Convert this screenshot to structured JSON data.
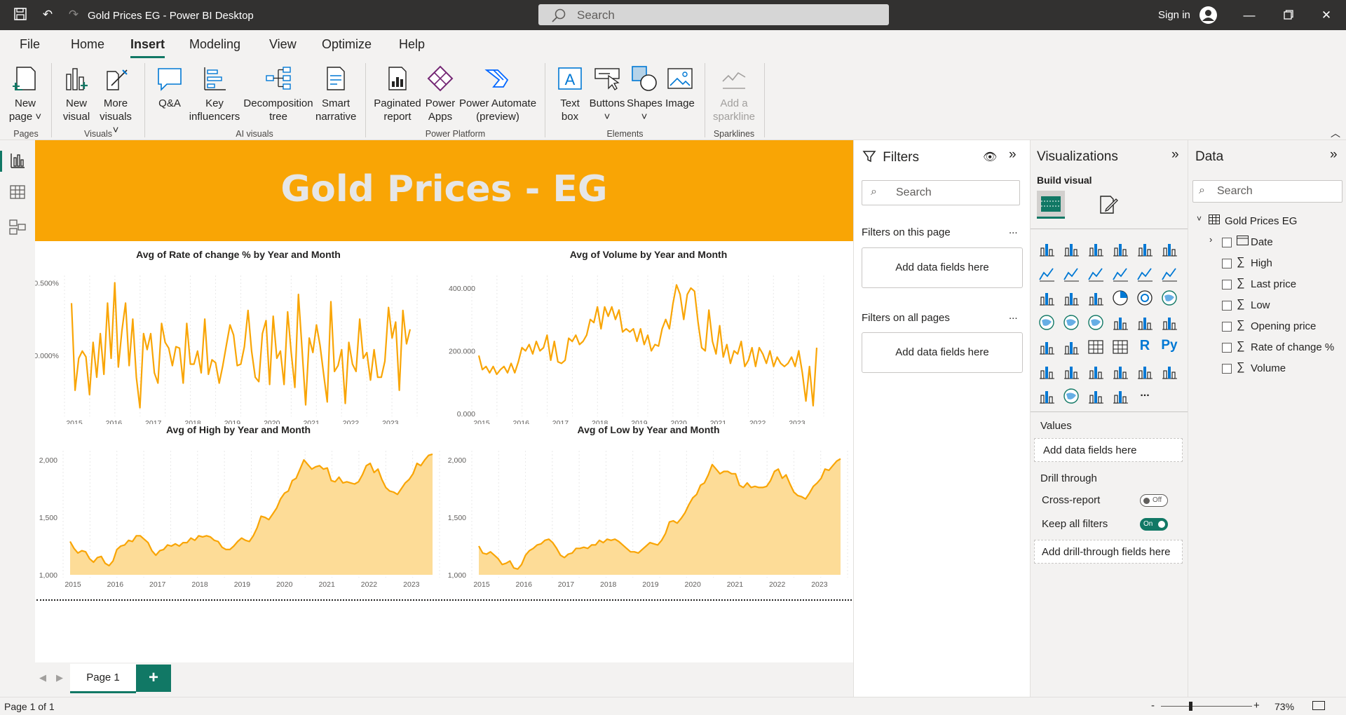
{
  "titlebar": {
    "app_title": "Gold Prices EG - Power BI Desktop",
    "search_placeholder": "Search",
    "sign_in": "Sign in"
  },
  "menu": {
    "tabs": [
      "File",
      "Home",
      "Insert",
      "Modeling",
      "View",
      "Optimize",
      "Help"
    ],
    "active": "Insert"
  },
  "ribbon": {
    "new_page": "New page",
    "new_visual": "New visual",
    "more_visuals": "More visuals",
    "qa": "Q&A",
    "key_influencers": "Key influencers",
    "decomposition_tree": "Decomposition tree",
    "smart_narrative": "Smart narrative",
    "paginated_report": "Paginated report",
    "power_apps": "Power Apps",
    "power_automate": "Power Automate (preview)",
    "text_box": "Text box",
    "buttons": "Buttons",
    "shapes": "Shapes",
    "image": "Image",
    "add_sparkline": "Add a sparkline",
    "groups": {
      "pages": "Pages",
      "visuals": "Visuals",
      "ai_visuals": "AI visuals",
      "power_platform": "Power Platform",
      "elements": "Elements",
      "sparklines": "Sparklines"
    }
  },
  "report": {
    "banner_title": "Gold Prices - EG",
    "banner_color": "#f9a505",
    "accent_color": "#f9a505",
    "area_fill": "#fddc97"
  },
  "chart_data": [
    {
      "type": "line",
      "title": "Avg of Rate of change % by Year and Month",
      "x_ticks": [
        "2015",
        "2016",
        "2017",
        "2018",
        "2019",
        "2020",
        "2021",
        "2022",
        "2023"
      ],
      "y_ticks": [
        "0.000%",
        "0.500%"
      ],
      "grid": true,
      "series": [
        {
          "values": [
            0.36,
            -0.24,
            -0.02,
            0.03,
            -0.01,
            -0.27,
            0.09,
            -0.15,
            0.15,
            -0.13,
            0.36,
            -0.02,
            0.5,
            -0.08,
            0.17,
            0.36,
            -0.07,
            0.25,
            -0.15,
            -0.36,
            0.15,
            0.04,
            0.15,
            -0.12,
            -0.19,
            0.22,
            0.09,
            0.05,
            -0.07,
            0.06,
            0.05,
            -0.19,
            0.22,
            -0.06,
            -0.06,
            0.03,
            -0.12,
            0.25,
            -0.13,
            -0.03,
            -0.05,
            -0.19,
            -0.07,
            0.07,
            0.21,
            0.14,
            -0.07,
            -0.06,
            0.06,
            0.31,
            0.03,
            -0.15,
            -0.18,
            0.15,
            0.24,
            -0.2,
            0.27,
            -0.02,
            0.03,
            -0.2,
            0.3,
            0.02,
            -0.22,
            0.42,
            0.04,
            -0.34,
            0.12,
            0.02,
            0.21,
            0.07,
            -0.13,
            -0.32,
            0.37,
            -0.11,
            -0.07,
            0.04,
            -0.33,
            0.09,
            -0.06,
            -0.11,
            0.25,
            -0.02,
            0.02,
            -0.17,
            0.04,
            -0.15,
            -0.15,
            -0.04,
            0.33,
            0.12,
            0.23,
            -0.24,
            0.31,
            0.08,
            0.18
          ]
        }
      ]
    },
    {
      "type": "line",
      "title": "Avg of Volume by Year and Month",
      "x_ticks": [
        "2015",
        "2016",
        "2017",
        "2018",
        "2019",
        "2020",
        "2021",
        "2022",
        "2023"
      ],
      "y_ticks": [
        "0.000",
        "200.000",
        "400.000"
      ],
      "grid": true,
      "series": [
        {
          "values": [
            185,
            140,
            150,
            130,
            150,
            125,
            140,
            150,
            130,
            160,
            130,
            165,
            210,
            200,
            220,
            190,
            230,
            200,
            210,
            250,
            170,
            230,
            165,
            160,
            170,
            240,
            230,
            250,
            220,
            230,
            250,
            300,
            290,
            340,
            270,
            340,
            310,
            340,
            300,
            330,
            260,
            270,
            260,
            270,
            230,
            270,
            220,
            250,
            200,
            220,
            215,
            270,
            300,
            270,
            350,
            410,
            380,
            300,
            380,
            400,
            390,
            290,
            210,
            200,
            330,
            230,
            190,
            280,
            180,
            220,
            160,
            200,
            190,
            230,
            150,
            170,
            210,
            150,
            210,
            190,
            160,
            200,
            150,
            180,
            160,
            150,
            160,
            180,
            150,
            200,
            130,
            40,
            150,
            25,
            210
          ]
        }
      ]
    },
    {
      "type": "area",
      "title": "Avg of High by Year and Month",
      "x_ticks": [
        "2015",
        "2016",
        "2017",
        "2018",
        "2019",
        "2020",
        "2021",
        "2022",
        "2023"
      ],
      "y_ticks": [
        "1,000",
        "1,500",
        "2,000"
      ],
      "grid": true,
      "series": [
        {
          "values": [
            1290,
            1230,
            1190,
            1210,
            1200,
            1140,
            1110,
            1150,
            1160,
            1100,
            1080,
            1120,
            1220,
            1250,
            1260,
            1300,
            1290,
            1340,
            1340,
            1310,
            1280,
            1210,
            1170,
            1210,
            1220,
            1260,
            1250,
            1270,
            1250,
            1280,
            1280,
            1320,
            1300,
            1340,
            1330,
            1340,
            1330,
            1300,
            1290,
            1240,
            1220,
            1220,
            1250,
            1290,
            1320,
            1300,
            1290,
            1340,
            1410,
            1510,
            1500,
            1480,
            1530,
            1580,
            1660,
            1710,
            1730,
            1820,
            1840,
            1920,
            2000,
            1960,
            1920,
            1940,
            1950,
            1920,
            1930,
            1820,
            1810,
            1850,
            1800,
            1810,
            1800,
            1790,
            1810,
            1870,
            1950,
            1970,
            1890,
            1920,
            1830,
            1760,
            1730,
            1720,
            1700,
            1750,
            1800,
            1830,
            1880,
            1970,
            1950,
            2000,
            2040,
            2050
          ]
        }
      ]
    },
    {
      "type": "area",
      "title": "Avg of Low by Year and Month",
      "x_ticks": [
        "2015",
        "2016",
        "2017",
        "2018",
        "2019",
        "2020",
        "2021",
        "2022",
        "2023"
      ],
      "y_ticks": [
        "1,000",
        "1,500",
        "2,000"
      ],
      "grid": true,
      "series": [
        {
          "values": [
            1250,
            1190,
            1180,
            1200,
            1170,
            1140,
            1090,
            1100,
            1120,
            1060,
            1050,
            1090,
            1170,
            1210,
            1230,
            1260,
            1270,
            1300,
            1310,
            1280,
            1230,
            1170,
            1150,
            1180,
            1190,
            1230,
            1230,
            1240,
            1230,
            1260,
            1260,
            1300,
            1280,
            1310,
            1300,
            1310,
            1290,
            1260,
            1230,
            1200,
            1200,
            1190,
            1220,
            1250,
            1280,
            1270,
            1260,
            1300,
            1360,
            1460,
            1470,
            1450,
            1490,
            1540,
            1610,
            1670,
            1700,
            1780,
            1800,
            1870,
            1960,
            1920,
            1880,
            1900,
            1900,
            1880,
            1880,
            1780,
            1760,
            1800,
            1760,
            1770,
            1760,
            1760,
            1770,
            1820,
            1900,
            1920,
            1840,
            1870,
            1790,
            1720,
            1690,
            1680,
            1660,
            1710,
            1770,
            1800,
            1840,
            1920,
            1910,
            1950,
            1990,
            2010
          ]
        }
      ]
    }
  ],
  "pages": {
    "current_tab": "Page 1",
    "status": "Page 1 of 1",
    "zoom": "73%"
  },
  "filters_pane": {
    "title": "Filters",
    "search_placeholder": "Search",
    "on_this_page": "Filters on this page",
    "on_all_pages": "Filters on all pages",
    "add_fields": "Add data fields here",
    "more": "..."
  },
  "viz_pane": {
    "title": "Visualizations",
    "build_visual": "Build visual",
    "values_label": "Values",
    "values_placeholder": "Add data fields here",
    "drill_through": "Drill through",
    "cross_report": "Cross-report",
    "cross_report_state": "Off",
    "keep_all_filters": "Keep all filters",
    "keep_all_filters_state": "On",
    "drill_placeholder": "Add drill-through fields here",
    "r_label": "R",
    "py_label": "Py",
    "more": "..."
  },
  "data_pane": {
    "title": "Data",
    "search_placeholder": "Search",
    "table_name": "Gold Prices EG",
    "fields": [
      {
        "name": "Date",
        "kind": "calendar-icon"
      },
      {
        "name": "High",
        "kind": "sigma-icon"
      },
      {
        "name": "Last price",
        "kind": "sigma-icon"
      },
      {
        "name": "Low",
        "kind": "sigma-icon"
      },
      {
        "name": "Opening price",
        "kind": "sigma-icon"
      },
      {
        "name": "Rate of change %",
        "kind": "sigma-icon"
      },
      {
        "name": "Volume",
        "kind": "sigma-icon"
      }
    ]
  }
}
